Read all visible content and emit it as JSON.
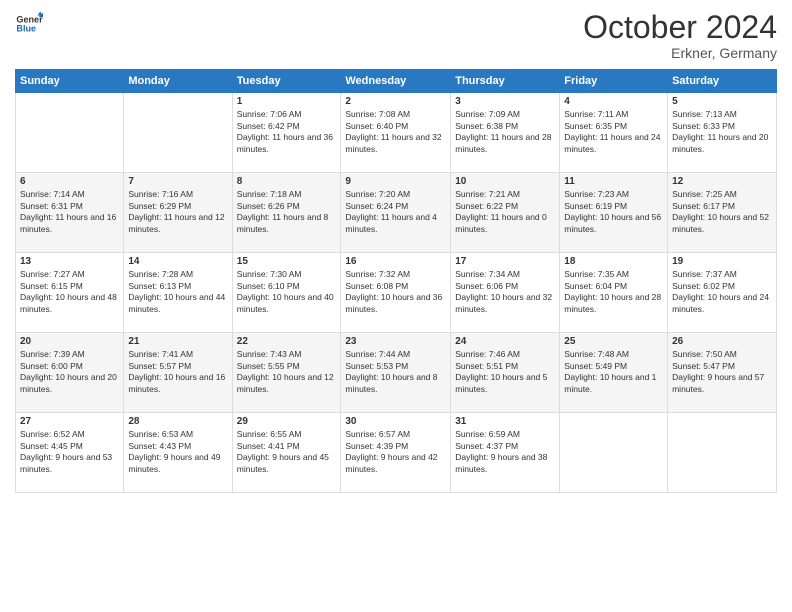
{
  "header": {
    "logo_line1": "General",
    "logo_line2": "Blue",
    "month_title": "October 2024",
    "subtitle": "Erkner, Germany"
  },
  "weekdays": [
    "Sunday",
    "Monday",
    "Tuesday",
    "Wednesday",
    "Thursday",
    "Friday",
    "Saturday"
  ],
  "weeks": [
    [
      {
        "day": "",
        "sunrise": "",
        "sunset": "",
        "daylight": ""
      },
      {
        "day": "",
        "sunrise": "",
        "sunset": "",
        "daylight": ""
      },
      {
        "day": "1",
        "sunrise": "Sunrise: 7:06 AM",
        "sunset": "Sunset: 6:42 PM",
        "daylight": "Daylight: 11 hours and 36 minutes."
      },
      {
        "day": "2",
        "sunrise": "Sunrise: 7:08 AM",
        "sunset": "Sunset: 6:40 PM",
        "daylight": "Daylight: 11 hours and 32 minutes."
      },
      {
        "day": "3",
        "sunrise": "Sunrise: 7:09 AM",
        "sunset": "Sunset: 6:38 PM",
        "daylight": "Daylight: 11 hours and 28 minutes."
      },
      {
        "day": "4",
        "sunrise": "Sunrise: 7:11 AM",
        "sunset": "Sunset: 6:35 PM",
        "daylight": "Daylight: 11 hours and 24 minutes."
      },
      {
        "day": "5",
        "sunrise": "Sunrise: 7:13 AM",
        "sunset": "Sunset: 6:33 PM",
        "daylight": "Daylight: 11 hours and 20 minutes."
      }
    ],
    [
      {
        "day": "6",
        "sunrise": "Sunrise: 7:14 AM",
        "sunset": "Sunset: 6:31 PM",
        "daylight": "Daylight: 11 hours and 16 minutes."
      },
      {
        "day": "7",
        "sunrise": "Sunrise: 7:16 AM",
        "sunset": "Sunset: 6:29 PM",
        "daylight": "Daylight: 11 hours and 12 minutes."
      },
      {
        "day": "8",
        "sunrise": "Sunrise: 7:18 AM",
        "sunset": "Sunset: 6:26 PM",
        "daylight": "Daylight: 11 hours and 8 minutes."
      },
      {
        "day": "9",
        "sunrise": "Sunrise: 7:20 AM",
        "sunset": "Sunset: 6:24 PM",
        "daylight": "Daylight: 11 hours and 4 minutes."
      },
      {
        "day": "10",
        "sunrise": "Sunrise: 7:21 AM",
        "sunset": "Sunset: 6:22 PM",
        "daylight": "Daylight: 11 hours and 0 minutes."
      },
      {
        "day": "11",
        "sunrise": "Sunrise: 7:23 AM",
        "sunset": "Sunset: 6:19 PM",
        "daylight": "Daylight: 10 hours and 56 minutes."
      },
      {
        "day": "12",
        "sunrise": "Sunrise: 7:25 AM",
        "sunset": "Sunset: 6:17 PM",
        "daylight": "Daylight: 10 hours and 52 minutes."
      }
    ],
    [
      {
        "day": "13",
        "sunrise": "Sunrise: 7:27 AM",
        "sunset": "Sunset: 6:15 PM",
        "daylight": "Daylight: 10 hours and 48 minutes."
      },
      {
        "day": "14",
        "sunrise": "Sunrise: 7:28 AM",
        "sunset": "Sunset: 6:13 PM",
        "daylight": "Daylight: 10 hours and 44 minutes."
      },
      {
        "day": "15",
        "sunrise": "Sunrise: 7:30 AM",
        "sunset": "Sunset: 6:10 PM",
        "daylight": "Daylight: 10 hours and 40 minutes."
      },
      {
        "day": "16",
        "sunrise": "Sunrise: 7:32 AM",
        "sunset": "Sunset: 6:08 PM",
        "daylight": "Daylight: 10 hours and 36 minutes."
      },
      {
        "day": "17",
        "sunrise": "Sunrise: 7:34 AM",
        "sunset": "Sunset: 6:06 PM",
        "daylight": "Daylight: 10 hours and 32 minutes."
      },
      {
        "day": "18",
        "sunrise": "Sunrise: 7:35 AM",
        "sunset": "Sunset: 6:04 PM",
        "daylight": "Daylight: 10 hours and 28 minutes."
      },
      {
        "day": "19",
        "sunrise": "Sunrise: 7:37 AM",
        "sunset": "Sunset: 6:02 PM",
        "daylight": "Daylight: 10 hours and 24 minutes."
      }
    ],
    [
      {
        "day": "20",
        "sunrise": "Sunrise: 7:39 AM",
        "sunset": "Sunset: 6:00 PM",
        "daylight": "Daylight: 10 hours and 20 minutes."
      },
      {
        "day": "21",
        "sunrise": "Sunrise: 7:41 AM",
        "sunset": "Sunset: 5:57 PM",
        "daylight": "Daylight: 10 hours and 16 minutes."
      },
      {
        "day": "22",
        "sunrise": "Sunrise: 7:43 AM",
        "sunset": "Sunset: 5:55 PM",
        "daylight": "Daylight: 10 hours and 12 minutes."
      },
      {
        "day": "23",
        "sunrise": "Sunrise: 7:44 AM",
        "sunset": "Sunset: 5:53 PM",
        "daylight": "Daylight: 10 hours and 8 minutes."
      },
      {
        "day": "24",
        "sunrise": "Sunrise: 7:46 AM",
        "sunset": "Sunset: 5:51 PM",
        "daylight": "Daylight: 10 hours and 5 minutes."
      },
      {
        "day": "25",
        "sunrise": "Sunrise: 7:48 AM",
        "sunset": "Sunset: 5:49 PM",
        "daylight": "Daylight: 10 hours and 1 minute."
      },
      {
        "day": "26",
        "sunrise": "Sunrise: 7:50 AM",
        "sunset": "Sunset: 5:47 PM",
        "daylight": "Daylight: 9 hours and 57 minutes."
      }
    ],
    [
      {
        "day": "27",
        "sunrise": "Sunrise: 6:52 AM",
        "sunset": "Sunset: 4:45 PM",
        "daylight": "Daylight: 9 hours and 53 minutes."
      },
      {
        "day": "28",
        "sunrise": "Sunrise: 6:53 AM",
        "sunset": "Sunset: 4:43 PM",
        "daylight": "Daylight: 9 hours and 49 minutes."
      },
      {
        "day": "29",
        "sunrise": "Sunrise: 6:55 AM",
        "sunset": "Sunset: 4:41 PM",
        "daylight": "Daylight: 9 hours and 45 minutes."
      },
      {
        "day": "30",
        "sunrise": "Sunrise: 6:57 AM",
        "sunset": "Sunset: 4:39 PM",
        "daylight": "Daylight: 9 hours and 42 minutes."
      },
      {
        "day": "31",
        "sunrise": "Sunrise: 6:59 AM",
        "sunset": "Sunset: 4:37 PM",
        "daylight": "Daylight: 9 hours and 38 minutes."
      },
      {
        "day": "",
        "sunrise": "",
        "sunset": "",
        "daylight": ""
      },
      {
        "day": "",
        "sunrise": "",
        "sunset": "",
        "daylight": ""
      }
    ]
  ]
}
